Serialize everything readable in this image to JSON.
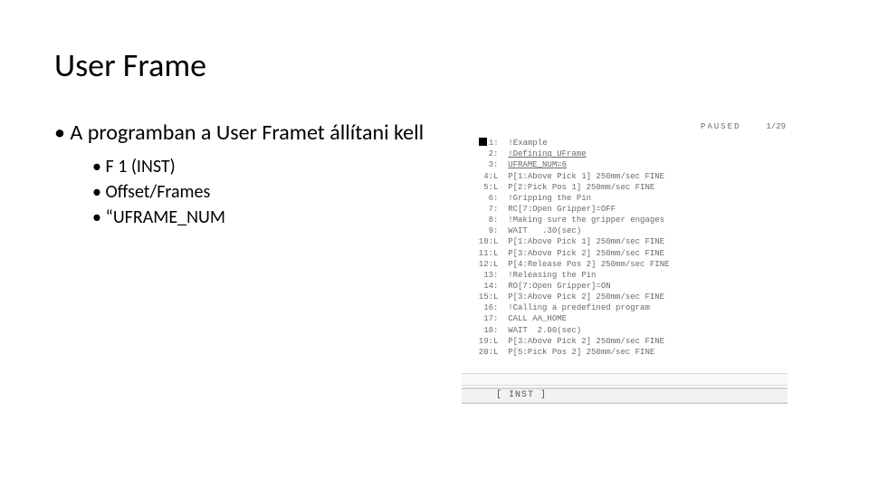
{
  "title": "User Frame",
  "bullets": {
    "main": "A programban a User Framet állítani kell",
    "subs": [
      "F 1 (INST)",
      "Offset/Frames",
      "“UFRAME_NUM"
    ]
  },
  "pendant": {
    "status": "PAUSED",
    "counter": "1/29",
    "lines": [
      {
        "n": "1:",
        "lead": "■",
        "txt": "!Example"
      },
      {
        "n": "2:",
        "txt": "!Defining UFrame",
        "u": true
      },
      {
        "n": "3:",
        "txt": "UFRAME_NUM=6",
        "u": true
      },
      {
        "n": "4:L",
        "txt": "P[1:Above Pick 1] 250mm/sec FINE"
      },
      {
        "n": "5:L",
        "txt": "P[2:Pick Pos 1] 250mm/sec FINE"
      },
      {
        "n": "6:",
        "txt": "!Gripping the Pin"
      },
      {
        "n": "7:",
        "txt": "RC[7:Open Gripper]=OFF"
      },
      {
        "n": "8:",
        "txt": "!Making sure the gripper engages"
      },
      {
        "n": "9:",
        "txt": "WAIT   .30(sec)"
      },
      {
        "n": "10:L",
        "txt": "P[1:Above Pick 1] 250mm/sec FINE"
      },
      {
        "n": "11:L",
        "txt": "P[3:Above Pick 2] 250mm/sec FINE"
      },
      {
        "n": "12:L",
        "txt": "P[4:Release Pos 2] 250mm/sec FINE"
      },
      {
        "n": "13:",
        "txt": "!Releasing the Pin"
      },
      {
        "n": "14:",
        "txt": "RO[7:Open Gripper]=ON"
      },
      {
        "n": "15:L",
        "txt": "P[3:Above Pick 2] 250mm/sec FINE"
      },
      {
        "n": "16:",
        "txt": "!Calling a predefined program"
      },
      {
        "n": "17:",
        "txt": "CALL AA_HOME"
      },
      {
        "n": "18:",
        "txt": "WAIT  2.00(sec)"
      },
      {
        "n": "19:L",
        "txt": "P[3:Above Pick 2] 250mm/sec FINE"
      },
      {
        "n": "20:L",
        "txt": "P[5:Pick Pos 2] 250mm/sec FINE"
      }
    ],
    "softkey": "[ INST ]"
  }
}
